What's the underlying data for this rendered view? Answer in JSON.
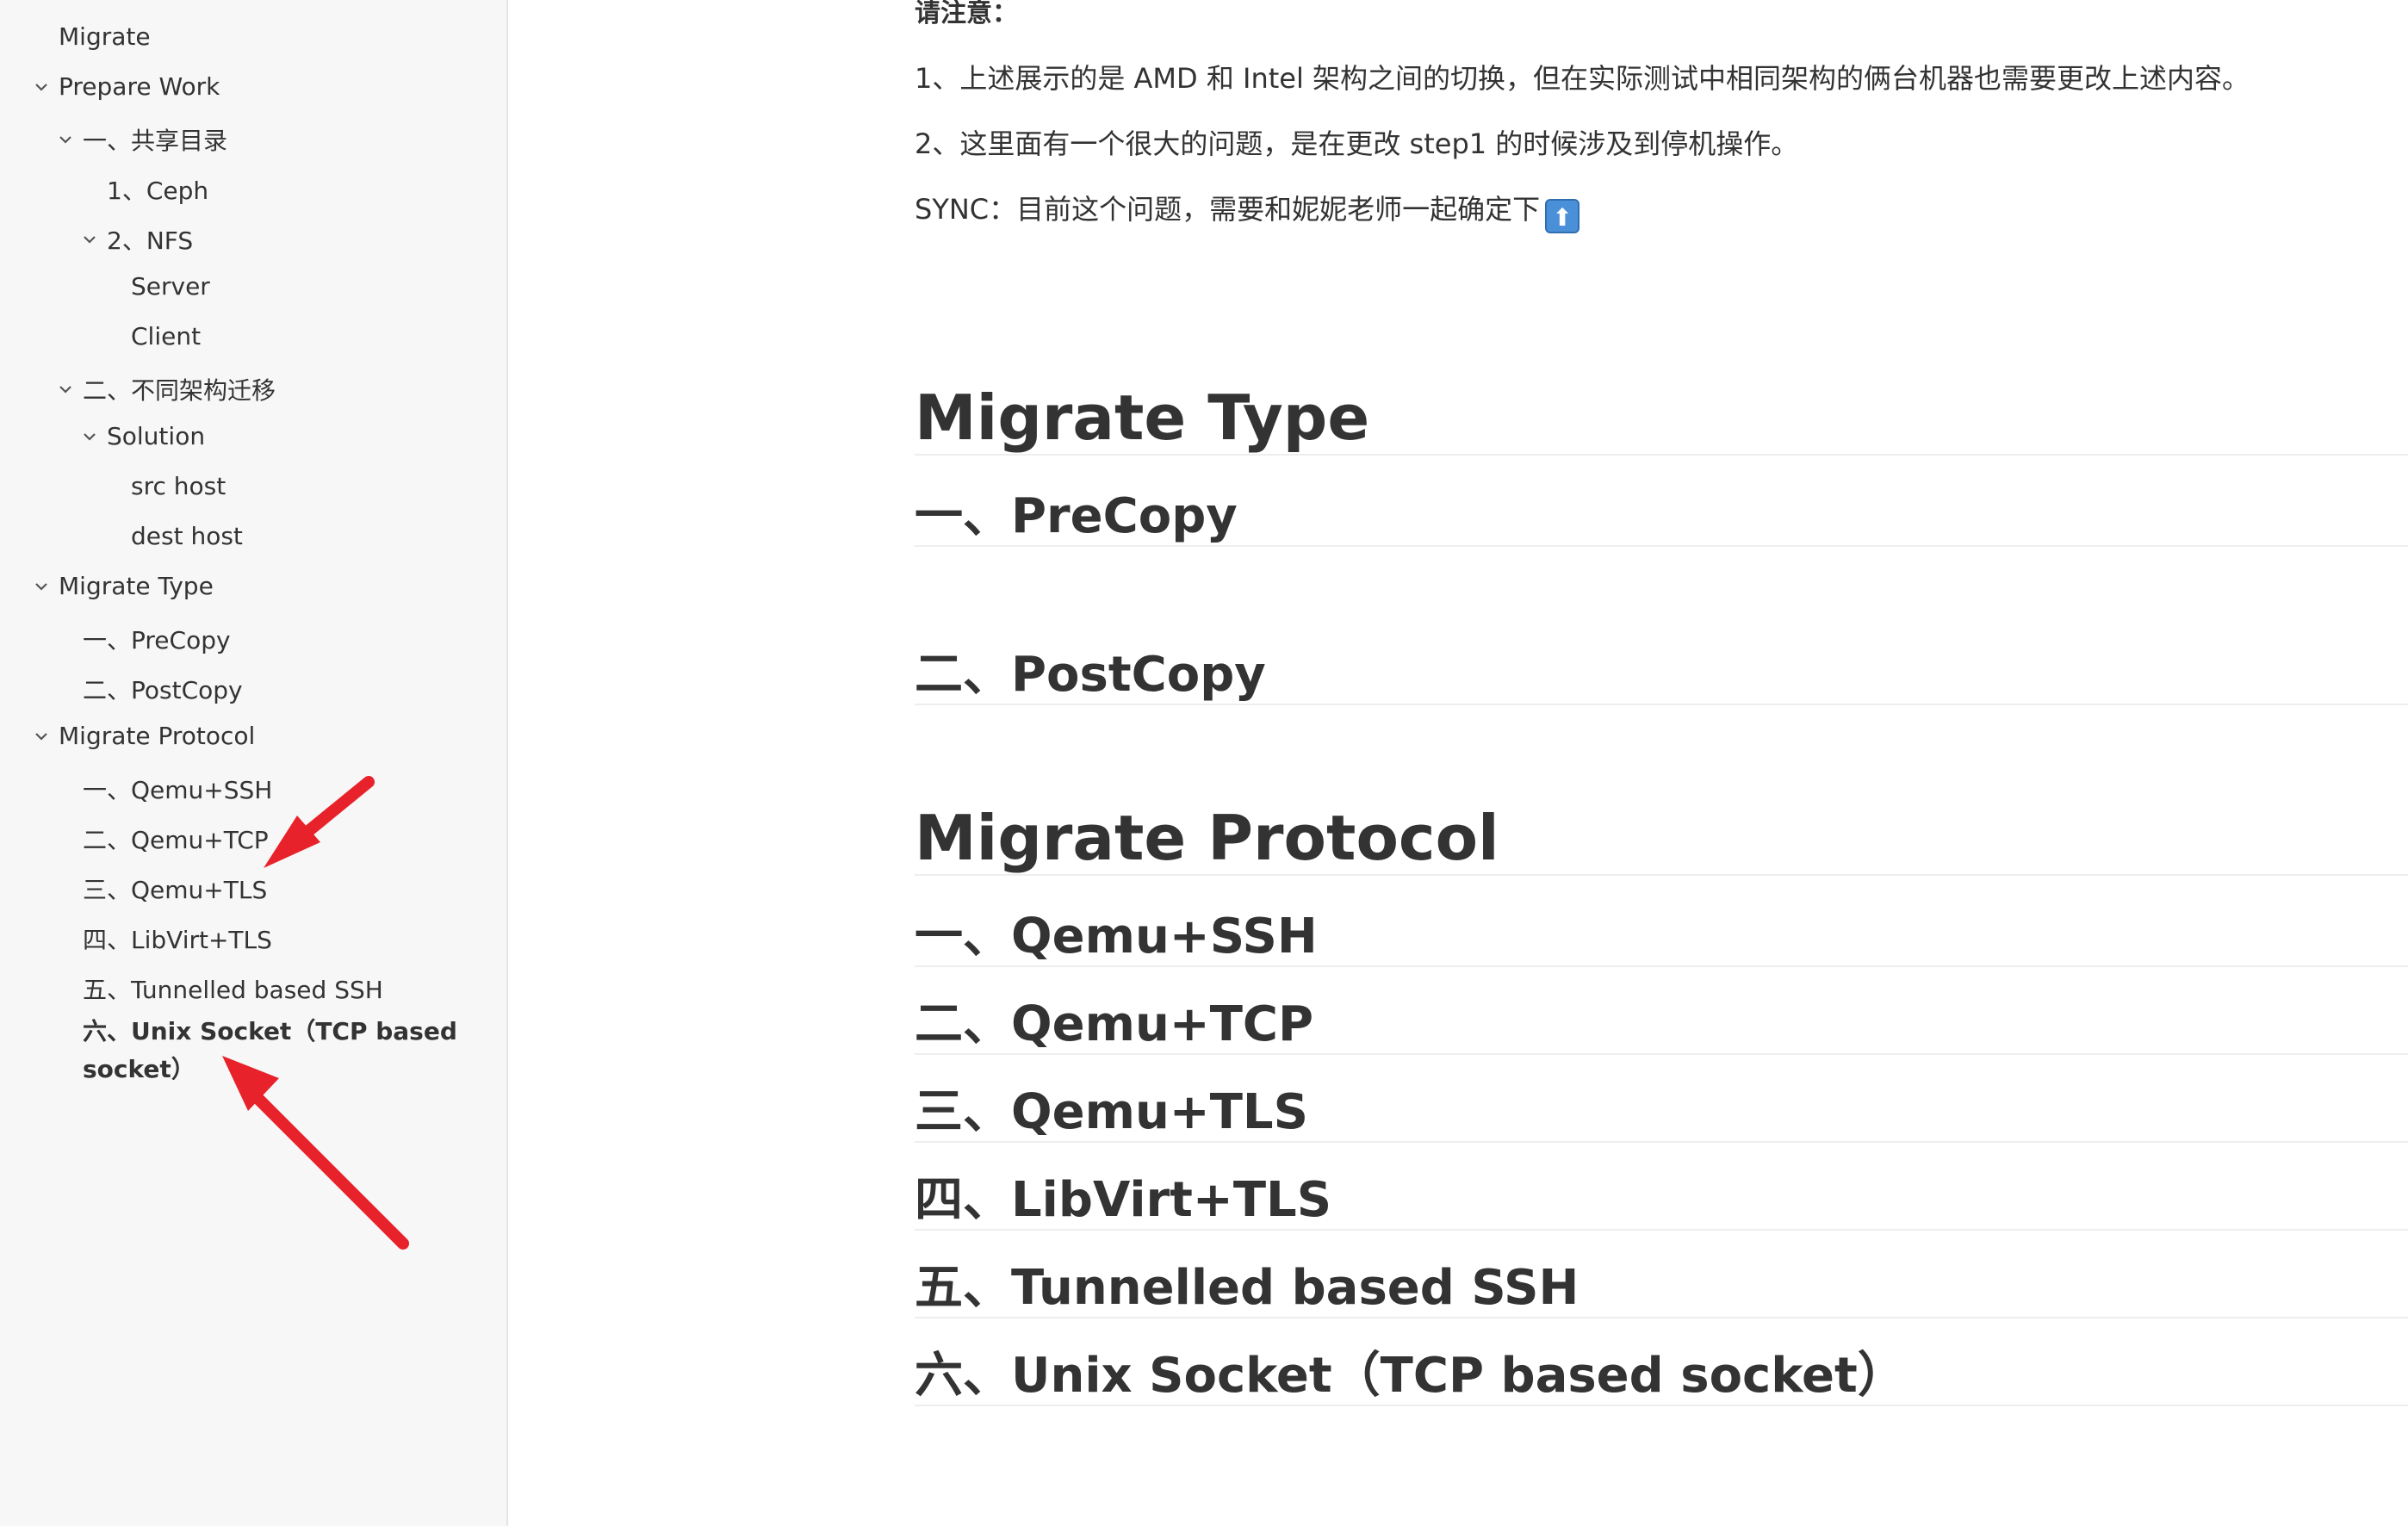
{
  "sidebar": {
    "items": [
      {
        "label": "Migrate"
      },
      {
        "label": "Prepare Work"
      },
      {
        "label": "一、共享目录"
      },
      {
        "label": "1、Ceph"
      },
      {
        "label": "2、NFS"
      },
      {
        "label": "Server"
      },
      {
        "label": "Client"
      },
      {
        "label": "二、不同架构迁移"
      },
      {
        "label": "Solution"
      },
      {
        "label": "src host"
      },
      {
        "label": "dest host"
      },
      {
        "label": "Migrate Type"
      },
      {
        "label": "一、PreCopy"
      },
      {
        "label": "二、PostCopy"
      },
      {
        "label": "Migrate Protocol"
      },
      {
        "label": "一、Qemu+SSH"
      },
      {
        "label": "二、Qemu+TCP"
      },
      {
        "label": "三、Qemu+TLS"
      },
      {
        "label": "四、LibVirt+TLS"
      },
      {
        "label": "五、Tunnelled based SSH"
      },
      {
        "label": "六、Unix Socket（TCP based socket）"
      }
    ],
    "annotation_color": "#e8222a"
  },
  "content": {
    "note_heading": "请注意：",
    "paragraphs": [
      "1、上述展示的是 AMD 和 Intel 架构之间的切换，但在实际测试中相同架构的俩台机器也需要更改上述内容。",
      "2、这里面有一个很大的问题，是在更改 step1 的时候涉及到停机操作。",
      "SYNC：目前这个问题，需要和妮妮老师一起确定下"
    ],
    "up_icon": "up-arrow-emoji",
    "headings": {
      "migrate_type": "Migrate Type",
      "precopy": "一、PreCopy",
      "postcopy": "二、PostCopy",
      "migrate_protocol": "Migrate Protocol",
      "qemu_ssh": "一、Qemu+SSH",
      "qemu_tcp": "二、Qemu+TCP",
      "qemu_tls": "三、Qemu+TLS",
      "libvirt_tls": "四、LibVirt+TLS",
      "tunnelled_ssh": "五、Tunnelled based SSH",
      "unix_socket": "六、Unix Socket（TCP based socket）"
    }
  }
}
